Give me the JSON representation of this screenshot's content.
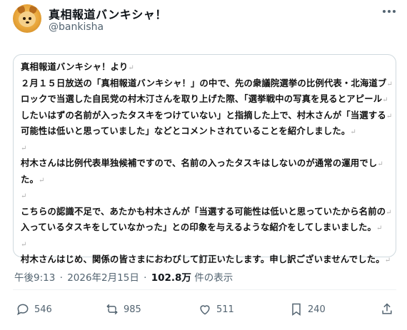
{
  "author": {
    "name": "真相報道バンキシャ！",
    "handle": "@bankisha",
    "avatar_icon": "dog-avatar-icon"
  },
  "post": {
    "lines": [
      "真相報道バンキシャ！より",
      "２月１５日放送の「真相報道バンキシャ！」の中で、先の衆議院選挙の比例代表・北海道ブ",
      "ロックで当選した自民党の村木汀さんを取り上げた際、「選挙戦中の写真を見るとアピール",
      "したいはずの名前が入ったタスキをつけていない」と指摘した上で、村木さんが「当選する",
      "可能性は低いと思っていました」などとコメントされていることを紹介しました。",
      "",
      "村木さんは比例代表単独候補ですので、名前の入ったタスキはしないのが通常の運用でし",
      "た。",
      "",
      "こちらの認識不足で、あたかも村木さんが「当選する可能性は低いと思っていたから名前の",
      "入っているタスキをしていなかった」との印象を与えるような紹介をしてしまいました。",
      "",
      "村木さんはじめ、関係の皆さまにおわびして訂正いたします。申し訳ございませんでした。"
    ],
    "return_mark": "↵",
    "time": "午後9:13",
    "date": "2026年2月15日",
    "views": "102.8万",
    "views_label": "件の表示"
  },
  "actions": {
    "replies": "546",
    "reposts": "985",
    "likes": "511",
    "bookmarks": "240"
  },
  "colors": {
    "text": "#0f1419",
    "secondary": "#536471",
    "border": "#cfd9de"
  }
}
